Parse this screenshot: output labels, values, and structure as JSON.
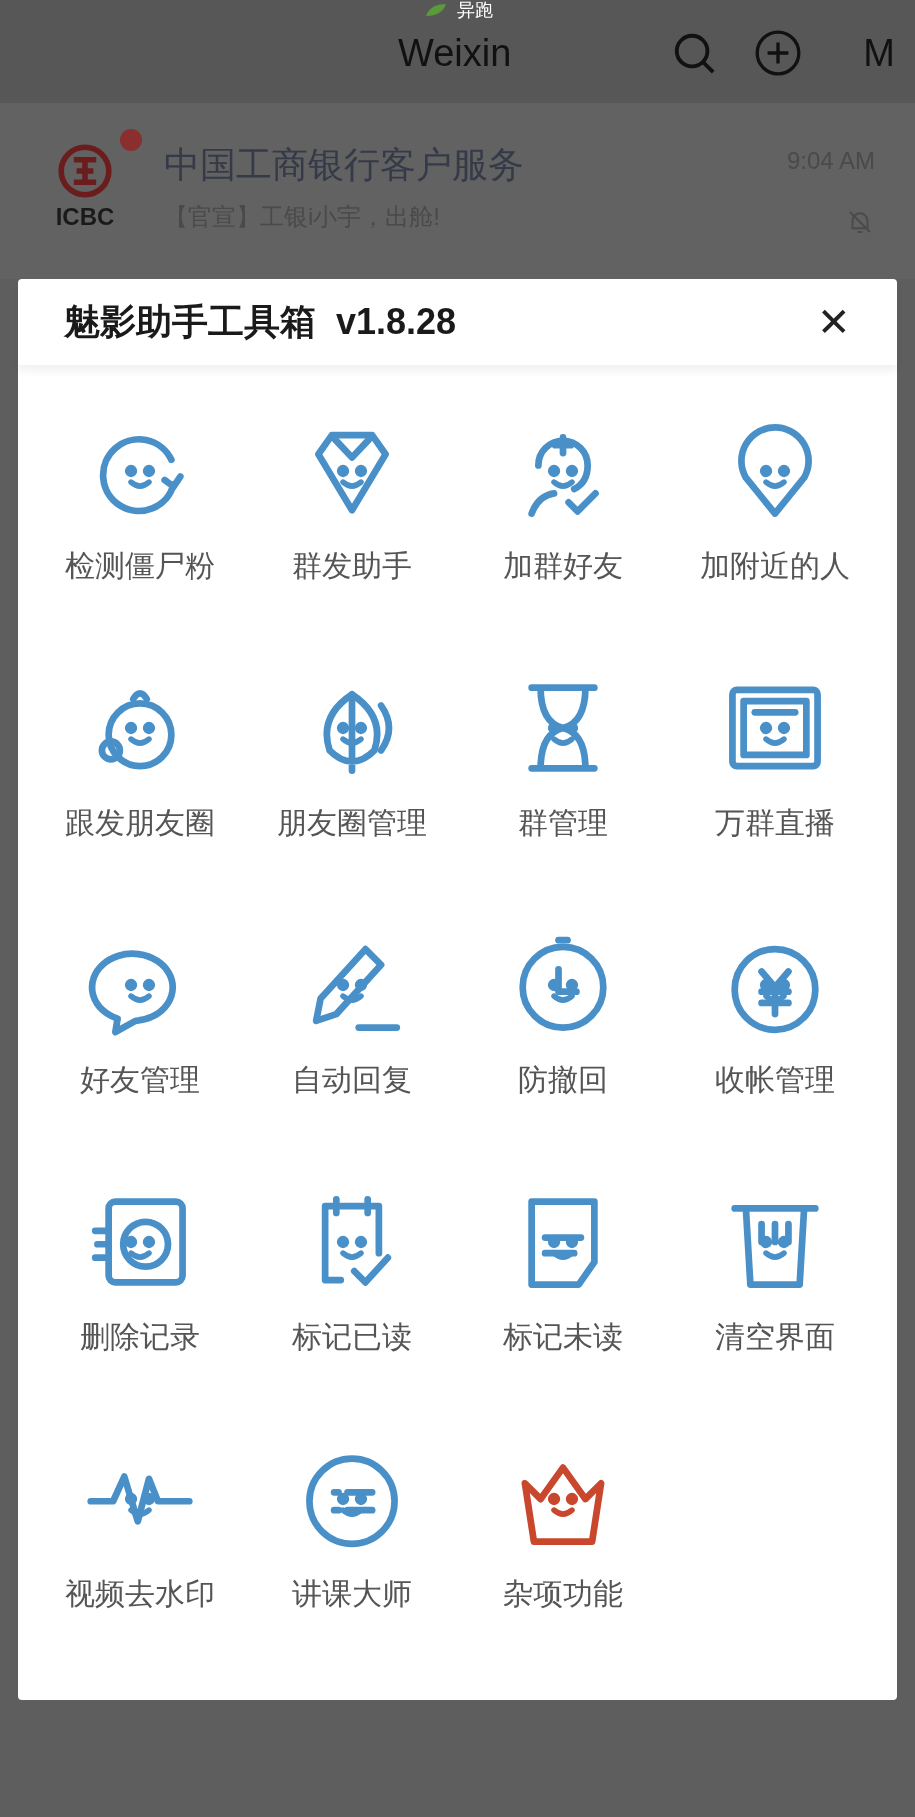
{
  "status": {
    "text": "异跑"
  },
  "header": {
    "title": "Weixin",
    "avatar_letter": "M"
  },
  "chat": {
    "name": "中国工商银行客户服务",
    "preview": "【官宣】工银i小宇，出舱!",
    "time": "9:04 AM",
    "logo_text": "ICBC",
    "unread": true,
    "muted": true
  },
  "dialog": {
    "title": "魅影助手工具箱  v1.8.28",
    "close": "✕",
    "tools": [
      {
        "label": "检测僵尸粉",
        "color": "#4a90c8"
      },
      {
        "label": "群发助手",
        "color": "#4a90c8"
      },
      {
        "label": "加群好友",
        "color": "#4a90c8"
      },
      {
        "label": "加附近的人",
        "color": "#4a90c8"
      },
      {
        "label": "跟发朋友圈",
        "color": "#4a90c8"
      },
      {
        "label": "朋友圈管理",
        "color": "#4a90c8"
      },
      {
        "label": "群管理",
        "color": "#4a90c8"
      },
      {
        "label": "万群直播",
        "color": "#4a90c8"
      },
      {
        "label": "好友管理",
        "color": "#4a90c8"
      },
      {
        "label": "自动回复",
        "color": "#4a90c8"
      },
      {
        "label": "防撤回",
        "color": "#4a90c8"
      },
      {
        "label": "收帐管理",
        "color": "#4a90c8"
      },
      {
        "label": "删除记录",
        "color": "#4a90c8"
      },
      {
        "label": "标记已读",
        "color": "#4a90c8"
      },
      {
        "label": "标记未读",
        "color": "#4a90c8"
      },
      {
        "label": "清空界面",
        "color": "#4a90c8"
      },
      {
        "label": "视频去水印",
        "color": "#4a90c8"
      },
      {
        "label": "讲课大师",
        "color": "#4a90c8"
      },
      {
        "label": "杂项功能",
        "color": "#c8472d"
      }
    ]
  }
}
